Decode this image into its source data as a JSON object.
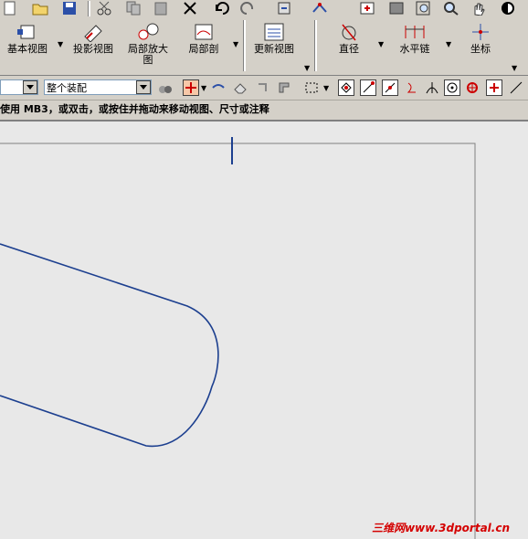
{
  "toolbar_top": {
    "icons": [
      "new-file-icon",
      "open-folder-icon",
      "save-icon",
      "cut-icon",
      "copy-icon",
      "paste-icon",
      "delete-icon",
      "undo-icon",
      "redo-icon",
      "repeat-command-icon",
      "view-triad-icon",
      "fit-icon",
      "shaded-icon",
      "zoom-window-icon",
      "zoom-icon",
      "pan-icon",
      "rotate-icon"
    ]
  },
  "command_toolbar": {
    "buttons": [
      {
        "label": "基本视图"
      },
      {
        "label": "投影视图"
      },
      {
        "label": "局部放大\n图"
      },
      {
        "label": "局部剖"
      },
      {
        "label": "更新视图"
      },
      {
        "label": "直径"
      },
      {
        "label": "水平链"
      },
      {
        "label": "坐标"
      }
    ]
  },
  "selection_bar": {
    "filter_value": "",
    "scope_value": "整个装配"
  },
  "cue_line": {
    "text": "使用 MB3，或双击，或按住并拖动来移动视图、尺寸或注释"
  },
  "watermark": {
    "text": "三维网www.3dportal.cn"
  },
  "colors": {
    "curve": "#1c3f8f",
    "background": "#e8e8e8",
    "toolbar": "#d4d0c8",
    "watermark": "#d40000"
  }
}
